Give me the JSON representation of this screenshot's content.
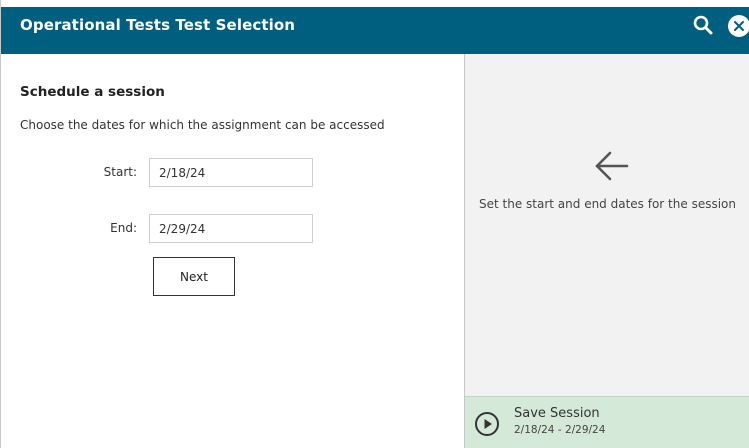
{
  "header": {
    "title": "Operational Tests  Test Selection",
    "search_icon": "search-icon",
    "close_icon": "close-icon",
    "color": "#005f7f"
  },
  "schedule": {
    "title": "Schedule a session",
    "subtitle": "Choose the dates for which the assignment can be accessed",
    "start_label": "Start:",
    "start_value": "2/18/24",
    "end_label": "End:",
    "end_value": "2/29/24",
    "next_label": "Next"
  },
  "help": {
    "arrow_icon": "arrow-left-icon",
    "message": "Set the start and end dates for the session"
  },
  "save_session": {
    "icon": "play-circle-icon",
    "label": "Save Session",
    "dates": "2/18/24 - 2/29/24",
    "color": "#d4e9d8"
  }
}
